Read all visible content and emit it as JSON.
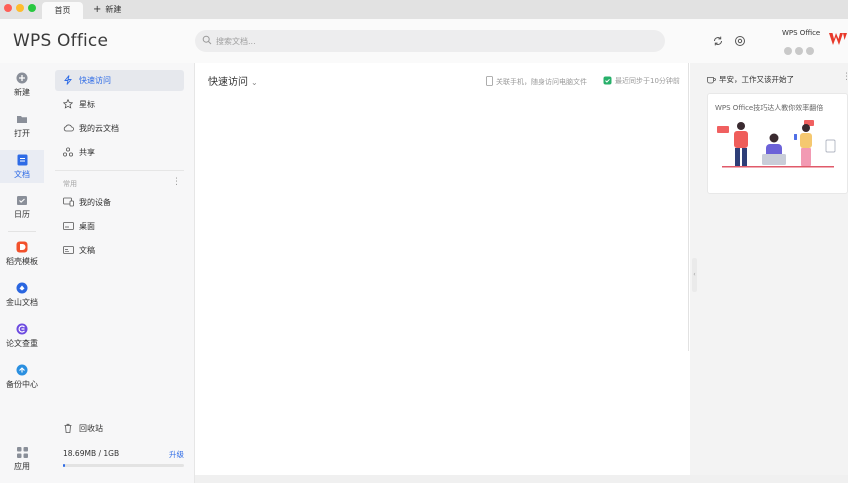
{
  "tabs": {
    "home": "首页",
    "new_tab": "新建"
  },
  "header": {
    "app_title": "WPS Office",
    "search_placeholder": "搜索文档...",
    "account_name": "WPS Office"
  },
  "rail": {
    "items": [
      {
        "label": "新建",
        "icon": "plus-circle-icon"
      },
      {
        "label": "打开",
        "icon": "folder-icon"
      },
      {
        "label": "文档",
        "icon": "document-icon"
      },
      {
        "label": "日历",
        "icon": "calendar-icon"
      },
      {
        "label": "稻壳模板",
        "icon": "docer-icon"
      },
      {
        "label": "金山文档",
        "icon": "kingsoft-docs-icon"
      },
      {
        "label": "论文查重",
        "icon": "paper-check-icon"
      },
      {
        "label": "备份中心",
        "icon": "backup-icon"
      },
      {
        "label": "应用",
        "icon": "apps-grid-icon"
      }
    ]
  },
  "nav": {
    "items": [
      {
        "label": "快速访问",
        "icon": "lightning-icon"
      },
      {
        "label": "星标",
        "icon": "star-icon"
      },
      {
        "label": "我的云文档",
        "icon": "cloud-icon"
      },
      {
        "label": "共享",
        "icon": "share-icon"
      }
    ],
    "section_label": "常用",
    "common": [
      {
        "label": "我的设备",
        "icon": "device-icon"
      },
      {
        "label": "桌面",
        "icon": "desktop-icon"
      },
      {
        "label": "文稿",
        "icon": "documents-folder-icon"
      }
    ],
    "recycle": "回收站",
    "storage_text": "18.69MB / 1GB",
    "upgrade": "升级",
    "storage_fraction": 0.018
  },
  "main": {
    "title": "快速访问",
    "link_phone": "关联手机，随身访问电脑文件",
    "sync_status": "最近同步于10分钟前"
  },
  "right": {
    "greeting": "早安，工作又该开始了",
    "card_text": "WPS Office技巧达人教你效率翻倍"
  },
  "colors": {
    "accent": "#2e6be6",
    "brand_red": "#e8392a"
  }
}
